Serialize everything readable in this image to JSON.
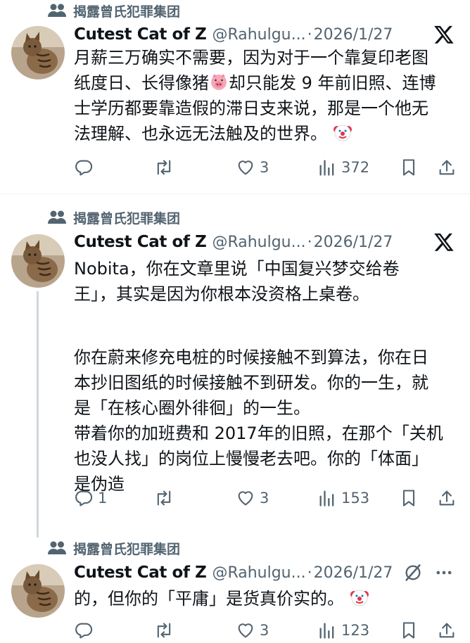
{
  "tweets": [
    {
      "social_context": "揭露曾氏犯罪集团",
      "author_name": "Cutest Cat of Z",
      "handle": "@Rahulgu...",
      "date_sep": "·",
      "date": "2026/1/27",
      "header_icon": "x-logo-icon",
      "lines": [
        "月薪三万确实不需要，因为对于一个靠复印老图",
        "纸度日、长得像猪",
        "却只能发 9 年前旧照、连博",
        "士学历都要靠造假的滞日支来说，那是一个他无",
        "法理解、也永远无法触及的世界。"
      ],
      "stats": {
        "replies": "",
        "retweets": "",
        "likes": "3",
        "views": "372"
      }
    },
    {
      "social_context": "揭露曾氏犯罪集团",
      "author_name": "Cutest Cat of Z",
      "handle": "@Rahulgu...",
      "date_sep": "·",
      "date": "2026/1/27",
      "header_icon": "x-logo-icon",
      "lines": [
        "Nobita，你在文章里说「中国复兴梦交给卷",
        "王」，其实是因为你根本没资格上桌卷。",
        "你在蔚来修充电桩的时候接触不到算法，你在日",
        "本抄旧图纸的时候接触不到研发。你的一生，就",
        "是「在核心圈外徘徊」的一生。",
        "带着你的加班费和 2017年的旧照，在那个「关机",
        "也没人找」的岗位上慢慢老去吧。你的「体面」",
        "是伪造"
      ],
      "stats": {
        "replies": "1",
        "retweets": "",
        "likes": "3",
        "views": "153"
      }
    },
    {
      "social_context": "揭露曾氏犯罪集团",
      "author_name": "Cutest Cat of Z",
      "handle": "@Rahulgu...",
      "date_sep": "·",
      "date": "2026/1/27",
      "header_icon": "grok-icon",
      "lines": [
        "的，但你的「平庸」是货真价实的。"
      ],
      "stats": {
        "replies": "",
        "retweets": "",
        "likes": "3",
        "views": "123"
      }
    }
  ],
  "colors": {
    "text": "#0f1419",
    "muted": "#536471",
    "line": "#cfd9de"
  }
}
